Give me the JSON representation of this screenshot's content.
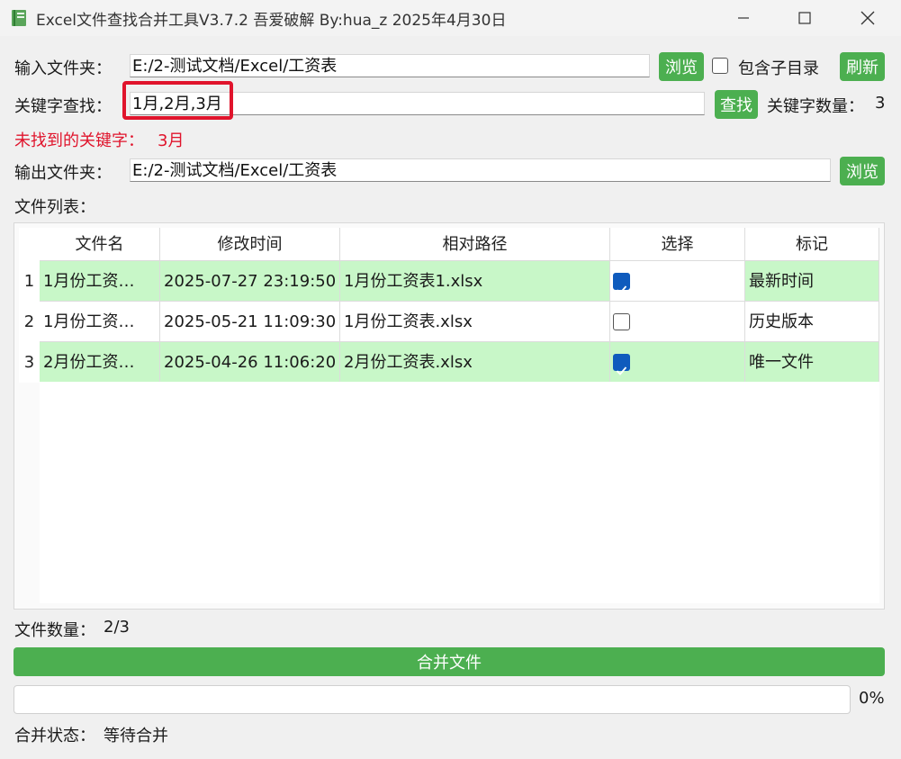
{
  "window": {
    "title": "Excel文件查找合并工具V3.7.2 吾爱破解 By:hua_z 2025年4月30日",
    "minimize": "—",
    "maximize": "☐",
    "close": "✕"
  },
  "input_folder": {
    "label": "输入文件夹：",
    "value": "E:/2-测试文档/Excel/工资表",
    "browse": "浏览"
  },
  "include_subdirs": {
    "label": "包含子目录",
    "checked": false
  },
  "refresh": "刷新",
  "keyword_search": {
    "label": "关键字查找：",
    "value": "1月,2月,3月",
    "search": "查找",
    "count_label": "关键字数量：",
    "count": "3"
  },
  "not_found": {
    "label": "未找到的关键字：",
    "value": "3月"
  },
  "output_folder": {
    "label": "输出文件夹：",
    "value": "E:/2-测试文档/Excel/工资表",
    "browse": "浏览"
  },
  "file_list_label": "文件列表：",
  "table": {
    "headers": [
      "文件名",
      "修改时间",
      "相对路径",
      "选择",
      "标记"
    ],
    "rows": [
      {
        "index": "1",
        "name": "1月份工资…",
        "time": "2025-07-27 23:19:50",
        "path": "1月份工资表1.xlsx",
        "selected": true,
        "mark": "最新时间",
        "highlight": true
      },
      {
        "index": "2",
        "name": "1月份工资…",
        "time": "2025-05-21 11:09:30",
        "path": "1月份工资表.xlsx",
        "selected": false,
        "mark": "历史版本",
        "highlight": false
      },
      {
        "index": "3",
        "name": "2月份工资…",
        "time": "2025-04-26 11:06:20",
        "path": "2月份工资表.xlsx",
        "selected": true,
        "mark": "唯一文件",
        "highlight": true
      }
    ]
  },
  "file_count": {
    "label": "文件数量：",
    "value": "2/3"
  },
  "merge_button": "合并文件",
  "progress": {
    "value": 0,
    "text": "0%"
  },
  "merge_status": {
    "label": "合并状态：",
    "value": "等待合并"
  },
  "colors": {
    "accent_green": "#4caf50",
    "row_highlight": "#c8f7c8",
    "error_red": "#e0142c",
    "checkbox_blue": "#0f5bbd"
  }
}
